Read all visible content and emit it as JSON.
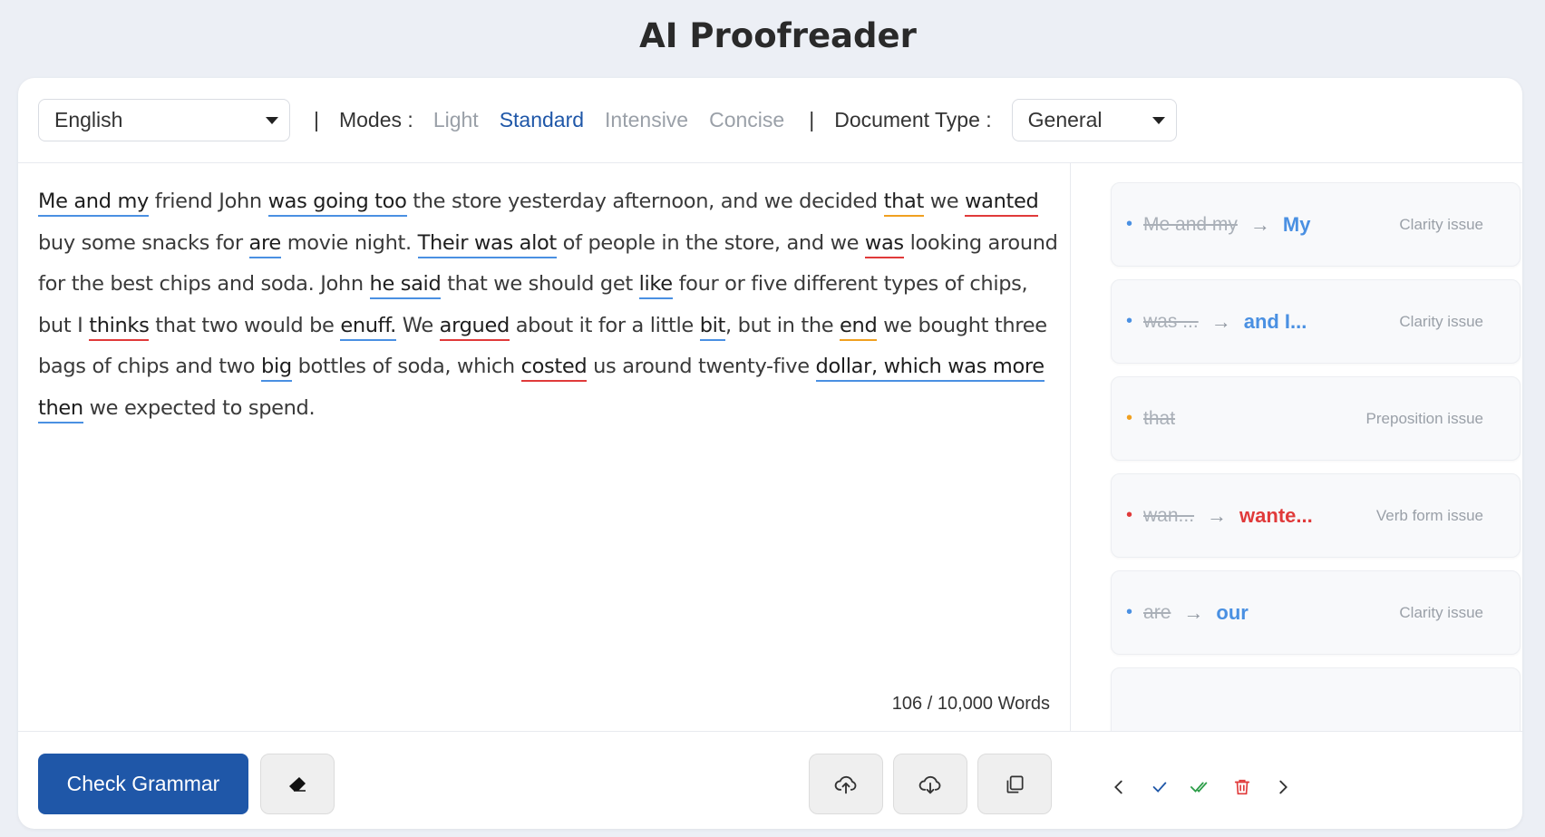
{
  "header": {
    "title": "AI Proofreader"
  },
  "toolbar": {
    "language": "English",
    "separator": "|",
    "modes_label": "Modes :",
    "modes": [
      "Light",
      "Standard",
      "Intensive",
      "Concise"
    ],
    "active_mode": "Standard",
    "doc_type_label": "Document Type :",
    "doc_type": "General"
  },
  "editor": {
    "segments": [
      {
        "t": "Me and my",
        "u": "blue"
      },
      {
        "t": " friend John "
      },
      {
        "t": "was going too",
        "u": "blue"
      },
      {
        "t": " the store yesterday afternoon, and we decided "
      },
      {
        "t": "that",
        "u": "orange"
      },
      {
        "t": " we "
      },
      {
        "t": "wanted",
        "u": "red"
      },
      {
        "t": " buy some snacks for "
      },
      {
        "t": "are",
        "u": "blue"
      },
      {
        "t": " movie night. "
      },
      {
        "t": "Their was alot",
        "u": "blue"
      },
      {
        "t": " of people in the store, and we "
      },
      {
        "t": "was",
        "u": "red"
      },
      {
        "t": " looking around for the best chips and soda. John "
      },
      {
        "t": "he said",
        "u": "blue"
      },
      {
        "t": " that we should get "
      },
      {
        "t": "like",
        "u": "blue"
      },
      {
        "t": " four or five different types of chips, but I "
      },
      {
        "t": "thinks",
        "u": "red"
      },
      {
        "t": " that two would be "
      },
      {
        "t": "enuff.",
        "u": "blue"
      },
      {
        "t": " We "
      },
      {
        "t": "argued",
        "u": "red"
      },
      {
        "t": " about it for a little "
      },
      {
        "t": "bit",
        "u": "blue"
      },
      {
        "t": ", but in the "
      },
      {
        "t": "end",
        "u": "orange"
      },
      {
        "t": " we bought three bags of chips and two "
      },
      {
        "t": "big",
        "u": "blue"
      },
      {
        "t": " bottles of soda, which "
      },
      {
        "t": "costed",
        "u": "red"
      },
      {
        "t": " us around twenty-five "
      },
      {
        "t": "dollar, which was more then",
        "u": "blue"
      },
      {
        "t": " we expected to spend."
      }
    ],
    "word_count": "106 / 10,000 Words"
  },
  "suggestions": [
    {
      "bullet": "•",
      "original": "Me and my",
      "arrow": "→",
      "fix": "My",
      "issue": "Clarity issue",
      "color": "#4a90e2"
    },
    {
      "bullet": "•",
      "original": "was ...",
      "arrow": "→",
      "fix": "and I...",
      "issue": "Clarity issue",
      "color": "#4a90e2"
    },
    {
      "bullet": "•",
      "original": "that",
      "arrow": "",
      "fix": "",
      "issue": "Preposition issue",
      "color": "#f0a020"
    },
    {
      "bullet": "•",
      "original": "wan...",
      "arrow": "→",
      "fix": "wante...",
      "issue": "Verb form issue",
      "color": "#e03a3a"
    },
    {
      "bullet": "•",
      "original": "are",
      "arrow": "→",
      "fix": "our",
      "issue": "Clarity issue",
      "color": "#4a90e2"
    }
  ],
  "footer": {
    "check_label": "Check Grammar",
    "icons": [
      "eraser-icon",
      "cloud-upload-icon",
      "cloud-download-icon",
      "copy-icon",
      "chevron-left-icon",
      "check-icon",
      "double-check-icon",
      "trash-icon",
      "chevron-right-icon"
    ]
  },
  "colors": {
    "accent": "#1f57a8",
    "underline_blue": "#4a90e2",
    "underline_red": "#e03a3a",
    "underline_orange": "#f0a020",
    "accept_green": "#2e9e4a",
    "delete_red": "#e03a3a"
  }
}
